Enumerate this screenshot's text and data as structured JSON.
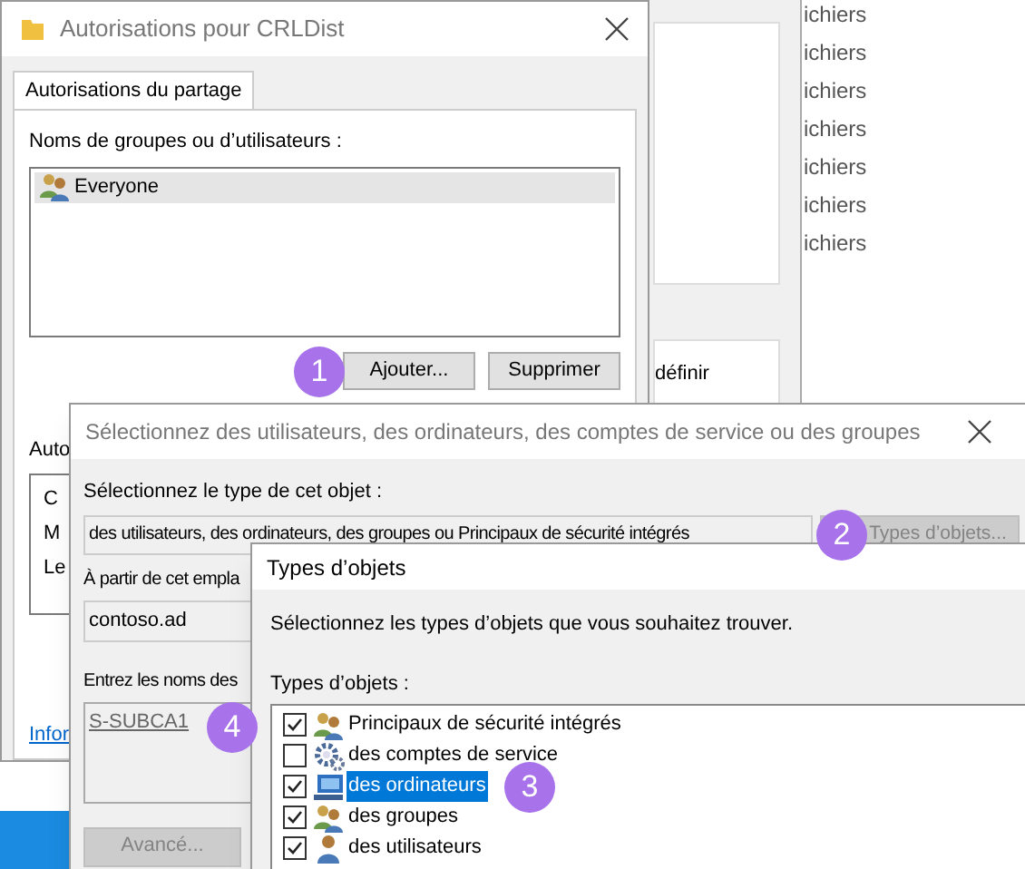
{
  "background_window": {
    "file_items": [
      "ichiers",
      "ichiers",
      "ichiers",
      "ichiers",
      "ichiers",
      "ichiers",
      "ichiers"
    ],
    "text": "définir"
  },
  "permissions_dialog": {
    "title": "Autorisations pour CRLDist",
    "tabs": [
      {
        "label": "Autorisations du partage",
        "selected": true
      }
    ],
    "group_label": "Noms de groupes ou d’utilisateurs :",
    "members": [
      {
        "name": "Everyone",
        "selected": true
      }
    ],
    "buttons": [
      "Ajouter...",
      "Supprimer"
    ],
    "callout": "1",
    "section_label": "Auto",
    "list_lines": [
      "C",
      "M",
      "Le"
    ],
    "link": "Infor"
  },
  "select_dialog": {
    "title": "Sélectionnez des utilisateurs, des ordinateurs, des comptes de service ou des groupes",
    "type_label": "Sélectionnez le type de cet objet :",
    "type_value": "des utilisateurs, des ordinateurs, des groupes ou Principaux de sécurité intégrés",
    "types_button": {
      "label": "Types d’objets...",
      "disabled": true
    },
    "callout": "2",
    "location_label": "À partir de cet empla",
    "location_value": "contoso.ad",
    "names_label": "Entrez les noms des",
    "names_value": "S-SUBCA1",
    "names_callout": "4",
    "advanced_button": {
      "label": "Avancé...",
      "disabled": true
    }
  },
  "types_dialog": {
    "title": "Types d’objets",
    "instruction": "Sélectionnez les types d’objets que vous souhaitez trouver.",
    "list_label": "Types d’objets :",
    "callout": "3",
    "items": [
      {
        "label": "Principaux de sécurité intégrés",
        "checked": true,
        "selected": false,
        "kind": "group"
      },
      {
        "label": "des comptes de service",
        "checked": false,
        "selected": false,
        "kind": "service"
      },
      {
        "label": "des ordinateurs",
        "checked": true,
        "selected": true,
        "kind": "computer"
      },
      {
        "label": "des groupes",
        "checked": true,
        "selected": false,
        "kind": "group"
      },
      {
        "label": "des utilisateurs",
        "checked": true,
        "selected": false,
        "kind": "user"
      }
    ]
  }
}
